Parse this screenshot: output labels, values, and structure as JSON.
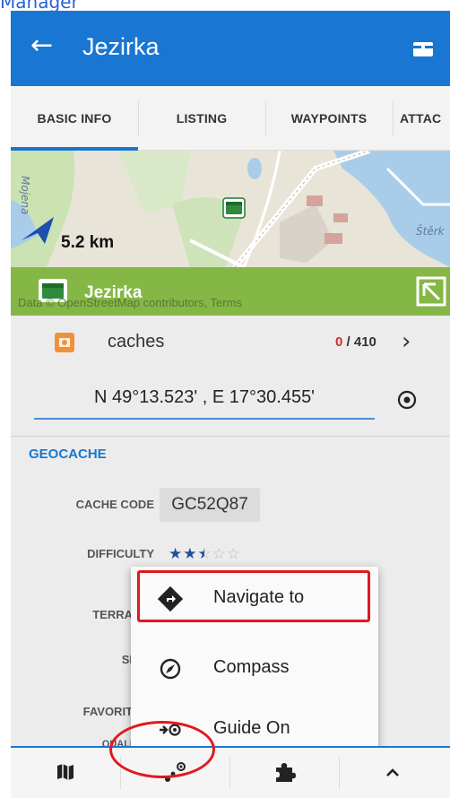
{
  "top_link": {
    "text": "Manager"
  },
  "appbar": {
    "back_icon": "arrow-left-icon",
    "title": "Jezirka",
    "action_icon": "cache-box-icon",
    "color": "#1976d2"
  },
  "tabs": [
    {
      "label": "BASIC INFO",
      "active": true
    },
    {
      "label": "LISTING",
      "active": false
    },
    {
      "label": "WAYPOINTS",
      "active": false
    },
    {
      "label": "ATTAC",
      "active": false
    }
  ],
  "map": {
    "distance": "5.2 km",
    "cache_name": "Jezirka",
    "attribution": "Data © OpenStreetMap contributors, Terms",
    "place_left": "Mojena",
    "place_right": "Štěrk"
  },
  "caches_row": {
    "label": "caches",
    "found": "0",
    "total": "/ 410"
  },
  "coordinates": {
    "value": "N 49°13.523' , E 17°30.455'"
  },
  "geocache": {
    "section_title": "GEOCACHE",
    "cache_code_label": "CACHE CODE",
    "cache_code": "GC52Q87",
    "difficulty_label": "DIFFICULTY",
    "difficulty": 2.5,
    "difficulty_max": 5,
    "terrain_label": "TERRA",
    "size_label": "SI",
    "favorites_label": "FAVORIT",
    "quality_label": "QUALI"
  },
  "popup_menu": [
    {
      "label": "Navigate to",
      "icon": "navigate-diamond-icon",
      "highlighted": true
    },
    {
      "label": "Compass",
      "icon": "compass-icon",
      "highlighted": false
    },
    {
      "label": "Guide On",
      "icon": "guide-on-icon",
      "highlighted": false
    }
  ],
  "bottom_bar": [
    {
      "icon": "map-icon"
    },
    {
      "icon": "route-dots-icon",
      "circled": true
    },
    {
      "icon": "puzzle-icon"
    },
    {
      "icon": "chevron-up-icon"
    }
  ],
  "colors": {
    "accent": "#1976d2",
    "highlight": "#e0191f",
    "map_banner": "#7bb33a"
  }
}
